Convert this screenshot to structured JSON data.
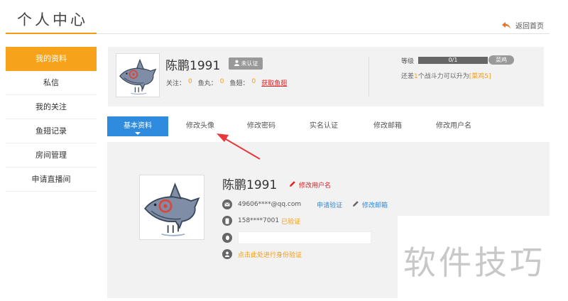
{
  "header": {
    "title": "个人中心",
    "back_home": "返回首页"
  },
  "sidebar": {
    "items": [
      {
        "label": "我的资料",
        "active": true
      },
      {
        "label": "私信"
      },
      {
        "label": "我的关注"
      },
      {
        "label": "鱼翅记录"
      },
      {
        "label": "房间管理"
      },
      {
        "label": "申请直播间"
      }
    ]
  },
  "profile": {
    "username": "陈鹏1991",
    "cert_badge": "未认证",
    "follow_label": "关注：",
    "follow_count": "0",
    "fishball_label": "鱼丸：",
    "fishball_count": "0",
    "fishfin_label": "鱼翅：",
    "fishfin_count": "0",
    "get_fishfin": "获取鱼翅"
  },
  "level": {
    "label": "等级",
    "progress_text": "0/1",
    "next_level": "菜鸡",
    "progress": 0,
    "tip_prefix": "还差",
    "tip_number": "1",
    "tip_middle": "个战斗力可以升为",
    "tip_target": "[菜鸡5]"
  },
  "tabs": [
    {
      "label": "基本资料",
      "active": true
    },
    {
      "label": "修改头像"
    },
    {
      "label": "修改密码"
    },
    {
      "label": "实名认证"
    },
    {
      "label": "修改邮箱"
    },
    {
      "label": "修改用户名"
    }
  ],
  "details": {
    "username": "陈鹏1991",
    "edit_username": "修改用户名",
    "email": "49606****@qq.com",
    "email_verify": "申请验证",
    "edit_email": "修改邮箱",
    "phone": "158****7001",
    "phone_status": "已验证",
    "qq": "",
    "id_verify": "点击此处进行身份验证"
  },
  "watermark": "软件技巧",
  "colors": {
    "accent_orange": "#f7a21b",
    "tab_blue": "#2e8bde",
    "link_red": "#d22222",
    "arrow_red": "#e8383d"
  }
}
